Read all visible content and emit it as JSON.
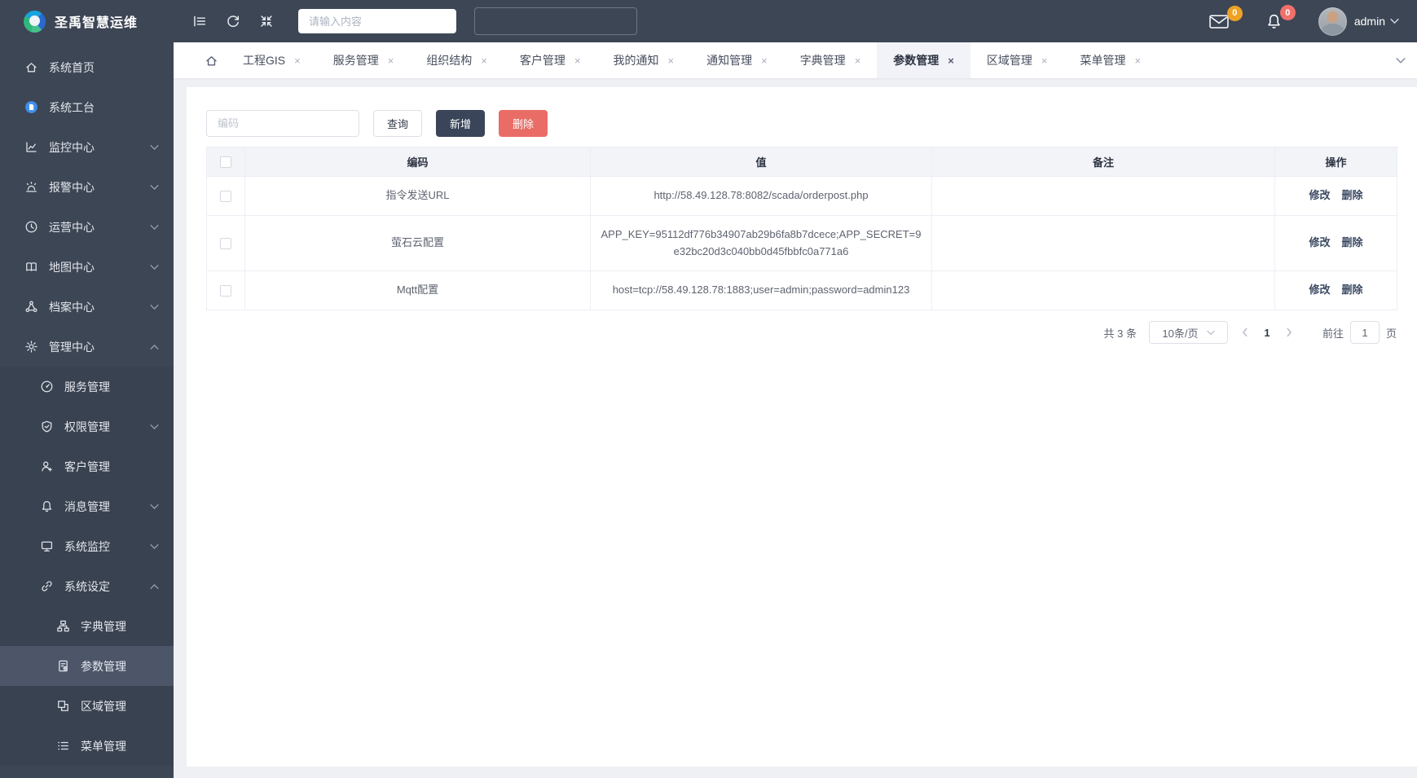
{
  "app": {
    "title": "圣禹智慧运维"
  },
  "header": {
    "search_placeholder": "请输入内容",
    "mail_badge": "0",
    "bell_badge": "0",
    "user": {
      "name": "admin"
    }
  },
  "sidebar": {
    "items": [
      {
        "key": "home",
        "label": "系统首页",
        "icon": "home-icon",
        "level": 0
      },
      {
        "key": "workbench",
        "label": "系统工台",
        "icon": "workbench-icon",
        "level": 0
      },
      {
        "key": "monitoring-center",
        "label": "监控中心",
        "icon": "line-chart-icon",
        "level": 0,
        "chevron": "down"
      },
      {
        "key": "alarm-center",
        "label": "报警中心",
        "icon": "alarm-icon",
        "level": 0,
        "chevron": "down"
      },
      {
        "key": "operation-center",
        "label": "运营中心",
        "icon": "clock-icon",
        "level": 0,
        "chevron": "down"
      },
      {
        "key": "map-center",
        "label": "地图中心",
        "icon": "map-book-icon",
        "level": 0,
        "chevron": "down"
      },
      {
        "key": "archive-center",
        "label": "档案中心",
        "icon": "share-nodes-icon",
        "level": 0,
        "chevron": "down"
      },
      {
        "key": "management-center",
        "label": "管理中心",
        "icon": "gear-icon",
        "level": 0,
        "chevron": "up"
      },
      {
        "key": "service-mgmt",
        "label": "服务管理",
        "icon": "gauge-icon",
        "level": 1
      },
      {
        "key": "permission-mgmt",
        "label": "权限管理",
        "icon": "shield-check-icon",
        "level": 1,
        "chevron": "down"
      },
      {
        "key": "customer-mgmt",
        "label": "客户管理",
        "icon": "customer-icon",
        "level": 1
      },
      {
        "key": "message-mgmt",
        "label": "消息管理",
        "icon": "bell-icon",
        "level": 1,
        "chevron": "down"
      },
      {
        "key": "system-monitor",
        "label": "系统监控",
        "icon": "display-icon",
        "level": 1,
        "chevron": "down"
      },
      {
        "key": "system-settings",
        "label": "系统设定",
        "icon": "link-icon",
        "level": 1,
        "chevron": "up"
      },
      {
        "key": "dict-mgmt",
        "label": "字典管理",
        "icon": "sitemap-icon",
        "level": 2
      },
      {
        "key": "param-mgmt",
        "label": "参数管理",
        "icon": "doc-gear-icon",
        "level": 2,
        "active": true
      },
      {
        "key": "region-mgmt",
        "label": "区域管理",
        "icon": "region-grid-icon",
        "level": 2
      },
      {
        "key": "menu-mgmt",
        "label": "菜单管理",
        "icon": "menu-list-icon",
        "level": 2
      }
    ]
  },
  "tabs": [
    {
      "key": "gis",
      "label": "工程GIS"
    },
    {
      "key": "service-mgmt",
      "label": "服务管理"
    },
    {
      "key": "org-structure",
      "label": "组织结构"
    },
    {
      "key": "customer-mgmt",
      "label": "客户管理"
    },
    {
      "key": "my-notices",
      "label": "我的通知"
    },
    {
      "key": "notice-mgmt",
      "label": "通知管理"
    },
    {
      "key": "dict-mgmt",
      "label": "字典管理"
    },
    {
      "key": "param-mgmt",
      "label": "参数管理",
      "active": true
    },
    {
      "key": "region-mgmt",
      "label": "区域管理"
    },
    {
      "key": "menu-mgmt",
      "label": "菜单管理"
    }
  ],
  "toolbar": {
    "code_placeholder": "编码",
    "query_label": "查询",
    "add_label": "新增",
    "delete_label": "删除"
  },
  "table": {
    "columns": [
      "编码",
      "值",
      "备注",
      "操作"
    ],
    "rows": [
      {
        "code": "指令发送URL",
        "value": "http://58.49.128.78:8082/scada/orderpost.php",
        "remark": "",
        "actions": [
          {
            "key": "edit",
            "label": "修改"
          },
          {
            "key": "delete",
            "label": "删除"
          }
        ]
      },
      {
        "code": "萤石云配置",
        "value": "APP_KEY=95112df776b34907ab29b6fa8b7dcece;APP_SECRET=9e32bc20d3c040bb0d45fbbfc0a771a6",
        "remark": "",
        "actions": [
          {
            "key": "edit",
            "label": "修改"
          },
          {
            "key": "delete",
            "label": "删除"
          }
        ]
      },
      {
        "code": "Mqtt配置",
        "value": "host=tcp://58.49.128.78:1883;user=admin;password=admin123",
        "remark": "",
        "actions": [
          {
            "key": "edit",
            "label": "修改"
          },
          {
            "key": "delete",
            "label": "删除"
          }
        ]
      }
    ]
  },
  "pagination": {
    "total_label": "共 3 条",
    "page_size": "10条/页",
    "current_page": "1",
    "goto_label": "前往",
    "goto_value": "1",
    "page_unit_label": "页"
  },
  "colors": {
    "sidebar_bg": "#3d4655",
    "sidebar_active_bg": "#4d5669",
    "primary_button": "#3a4559",
    "danger_button": "#e96d66",
    "mail_badge": "#eda225",
    "bell_badge": "#f1706a",
    "active_tab_bg": "#f1f3f8",
    "table_header_bg": "#f2f4f8",
    "workbench_icon_blue": "#3f8fe8"
  }
}
